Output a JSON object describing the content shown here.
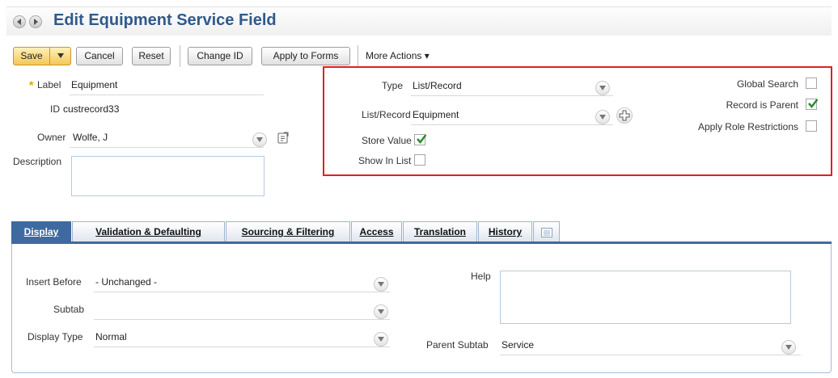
{
  "header": {
    "title": "Edit Equipment Service Field"
  },
  "toolbar": {
    "save_label": "Save",
    "cancel_label": "Cancel",
    "reset_label": "Reset",
    "change_id_label": "Change ID",
    "apply_label": "Apply to Forms",
    "more_actions_label": "More Actions ▾"
  },
  "form": {
    "required_mark": "*",
    "label_label": "Label",
    "label_value": "Equipment",
    "id_label": "ID",
    "id_value": "custrecord33",
    "owner_label": "Owner",
    "owner_value": "Wolfe, J",
    "description_label": "Description"
  },
  "type_section": {
    "type_label": "Type",
    "type_value": "List/Record",
    "list_record_label": "List/Record",
    "list_record_value": "Equipment",
    "store_value_label": "Store Value",
    "store_value_checked": true,
    "show_in_list_label": "Show In List",
    "show_in_list_checked": false
  },
  "options": {
    "global_search_label": "Global Search",
    "global_search_checked": false,
    "record_is_parent_label": "Record is Parent",
    "record_is_parent_checked": true,
    "apply_role_label": "Apply Role Restrictions",
    "apply_role_checked": false
  },
  "tabs": [
    {
      "label": "Display",
      "active": true
    },
    {
      "label": "Validation & Defaulting"
    },
    {
      "label": "Sourcing & Filtering"
    },
    {
      "label": "Access"
    },
    {
      "label": "Translation"
    },
    {
      "label": "History"
    }
  ],
  "display_tab": {
    "insert_before_label": "Insert Before",
    "insert_before_value": "- Unchanged -",
    "subtab_label": "Subtab",
    "subtab_value": "",
    "display_type_label": "Display Type",
    "display_type_value": "Normal",
    "help_label": "Help",
    "parent_subtab_label": "Parent Subtab",
    "parent_subtab_value": "Service"
  },
  "colors": {
    "accent": "#3f6aa0",
    "title": "#2f5a8a",
    "highlight_border": "#e02020",
    "check": "#2e8b2e"
  }
}
